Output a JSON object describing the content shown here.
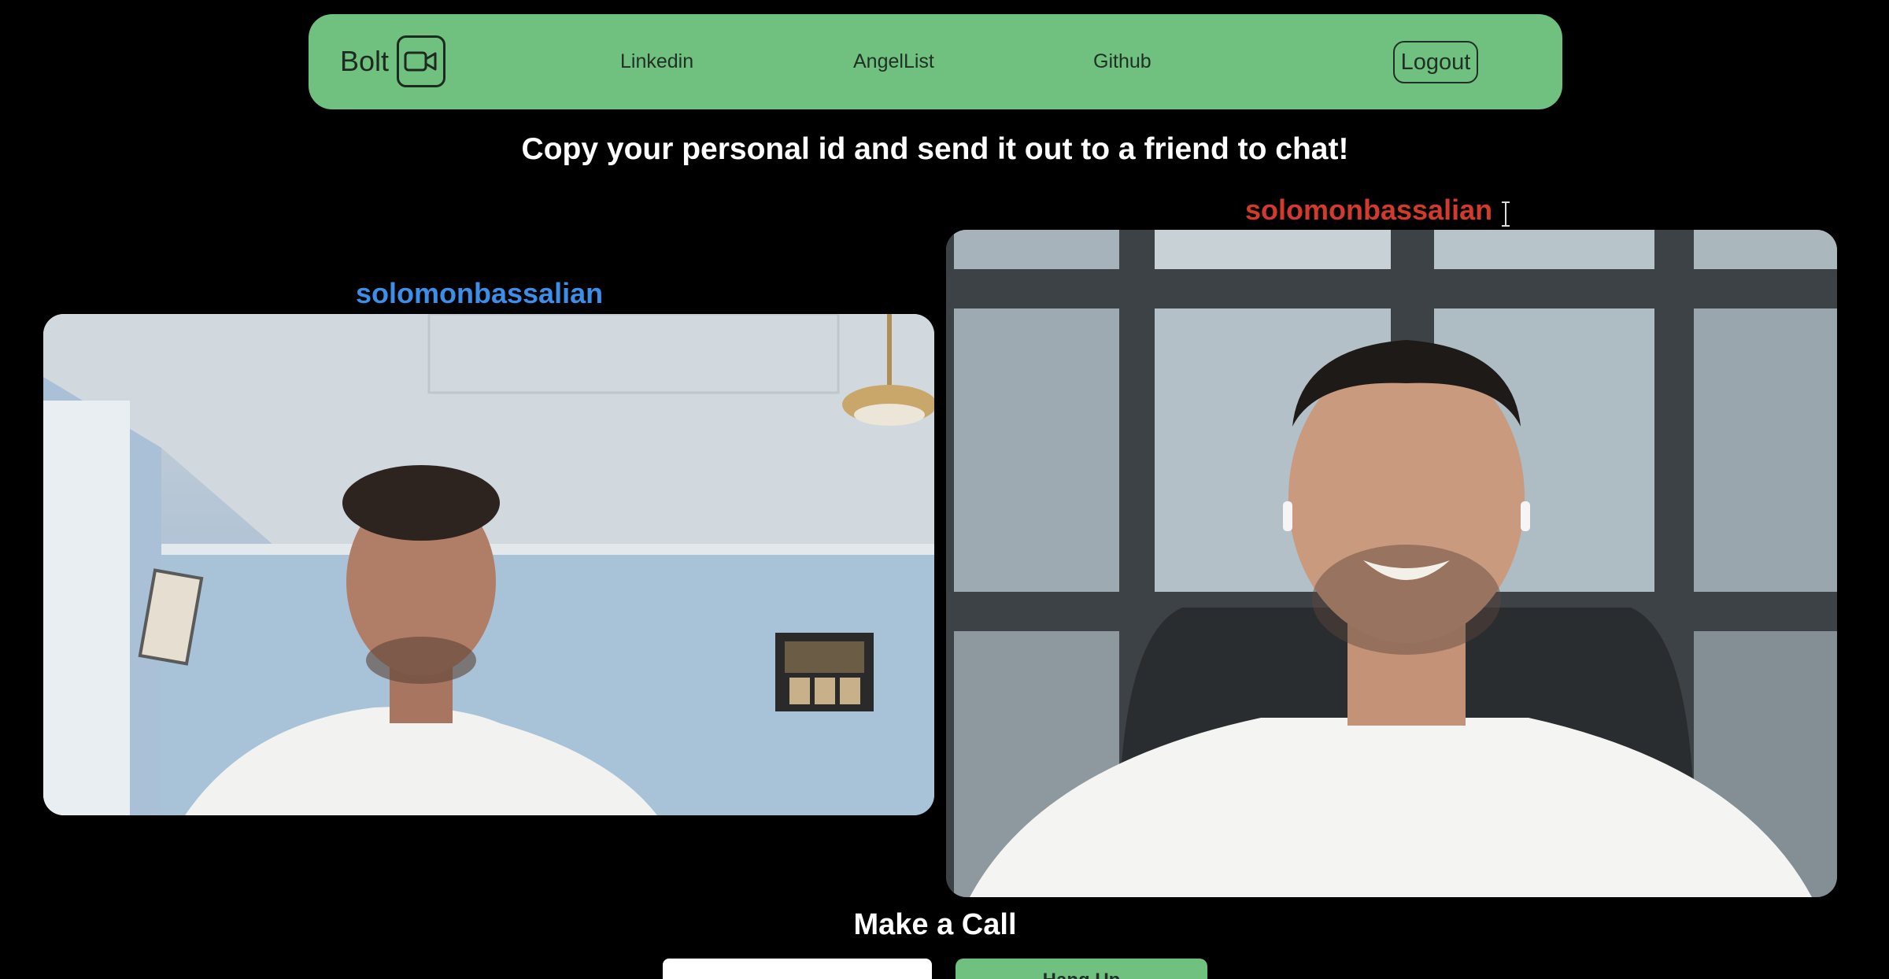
{
  "navbar": {
    "brand": "Bolt",
    "brand_icon": "video-camera-icon",
    "links": [
      {
        "label": "Linkedin"
      },
      {
        "label": "AngelList"
      },
      {
        "label": "Github"
      }
    ],
    "logout_label": "Logout",
    "color": "#70c07f"
  },
  "instruction": "Copy your personal id and send it out to a friend to chat!",
  "local_video": {
    "username": "solomonbassalian",
    "label_color": "#3d8ee8"
  },
  "remote_video": {
    "username": "solomonbassalian",
    "label_color": "#d13a2d"
  },
  "call": {
    "heading": "Make a Call",
    "button_label": "Hang Up"
  }
}
